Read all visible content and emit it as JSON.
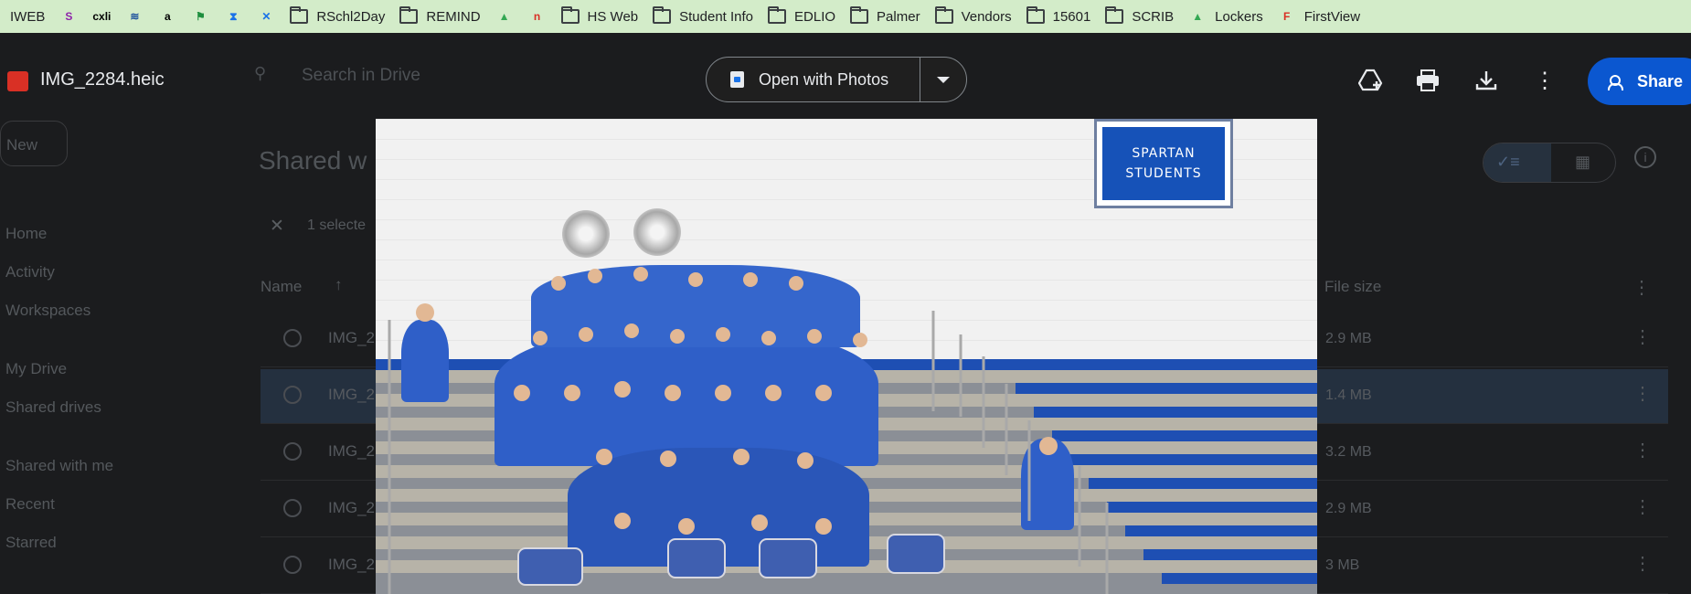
{
  "bookmarks": [
    {
      "label": "IWEB",
      "icon": "iweb-icon",
      "type": "site"
    },
    {
      "label": "",
      "icon": "shield-s-icon",
      "type": "site"
    },
    {
      "label": "",
      "icon": "cxli-icon",
      "type": "site"
    },
    {
      "label": "",
      "icon": "wave-icon",
      "type": "site"
    },
    {
      "label": "",
      "icon": "amazon-icon",
      "type": "site"
    },
    {
      "label": "",
      "icon": "green-flag-icon",
      "type": "site"
    },
    {
      "label": "",
      "icon": "hourglass-icon",
      "type": "site"
    },
    {
      "label": "",
      "icon": "cross-arrows-icon",
      "type": "site"
    },
    {
      "label": "RSchl2Day",
      "icon": "folder-icon",
      "type": "folder"
    },
    {
      "label": "REMIND",
      "icon": "folder-icon",
      "type": "folder"
    },
    {
      "label": "",
      "icon": "google-drive-icon",
      "type": "site"
    },
    {
      "label": "",
      "icon": "n-icon",
      "type": "site"
    },
    {
      "label": "HS Web",
      "icon": "folder-icon",
      "type": "folder"
    },
    {
      "label": "Student Info",
      "icon": "folder-icon",
      "type": "folder"
    },
    {
      "label": "EDLIO",
      "icon": "folder-icon",
      "type": "folder"
    },
    {
      "label": "Palmer",
      "icon": "folder-icon",
      "type": "folder"
    },
    {
      "label": "Vendors",
      "icon": "folder-icon",
      "type": "folder"
    },
    {
      "label": "15601",
      "icon": "folder-icon",
      "type": "folder"
    },
    {
      "label": "SCRIB",
      "icon": "folder-icon",
      "type": "folder"
    },
    {
      "label": "Lockers",
      "icon": "google-drive-icon",
      "type": "site"
    },
    {
      "label": "FirstView",
      "icon": "firstview-icon",
      "type": "site"
    }
  ],
  "viewer": {
    "file_name": "IMG_2284.heic",
    "open_with": "Open with Photos",
    "share": "Share",
    "sign_line1": "SPARTAN",
    "sign_line2": "STUDENTS"
  },
  "drive": {
    "search_placeholder": "Search in Drive",
    "new": "New",
    "page_title": "Shared w",
    "selected": "1 selecte",
    "col_name": "Name",
    "col_size": "File size",
    "nav": [
      "Home",
      "Activity",
      "Workspaces",
      "My Drive",
      "Shared drives",
      "Shared with me",
      "Recent",
      "Starred"
    ],
    "rows": [
      {
        "name": "IMG_2",
        "size": "2.9 MB"
      },
      {
        "name": "IMG_2",
        "size": "1.4 MB"
      },
      {
        "name": "IMG_2",
        "size": "3.2 MB"
      },
      {
        "name": "IMG_2",
        "size": "2.9 MB"
      },
      {
        "name": "IMG_2",
        "size": "3 MB"
      }
    ]
  },
  "colors": {
    "bookmark_bar": "#d3ecc9",
    "share_blue": "#0b57d0",
    "sign_blue": "#1652b8",
    "shirt_blue": "#2f5fc8"
  }
}
